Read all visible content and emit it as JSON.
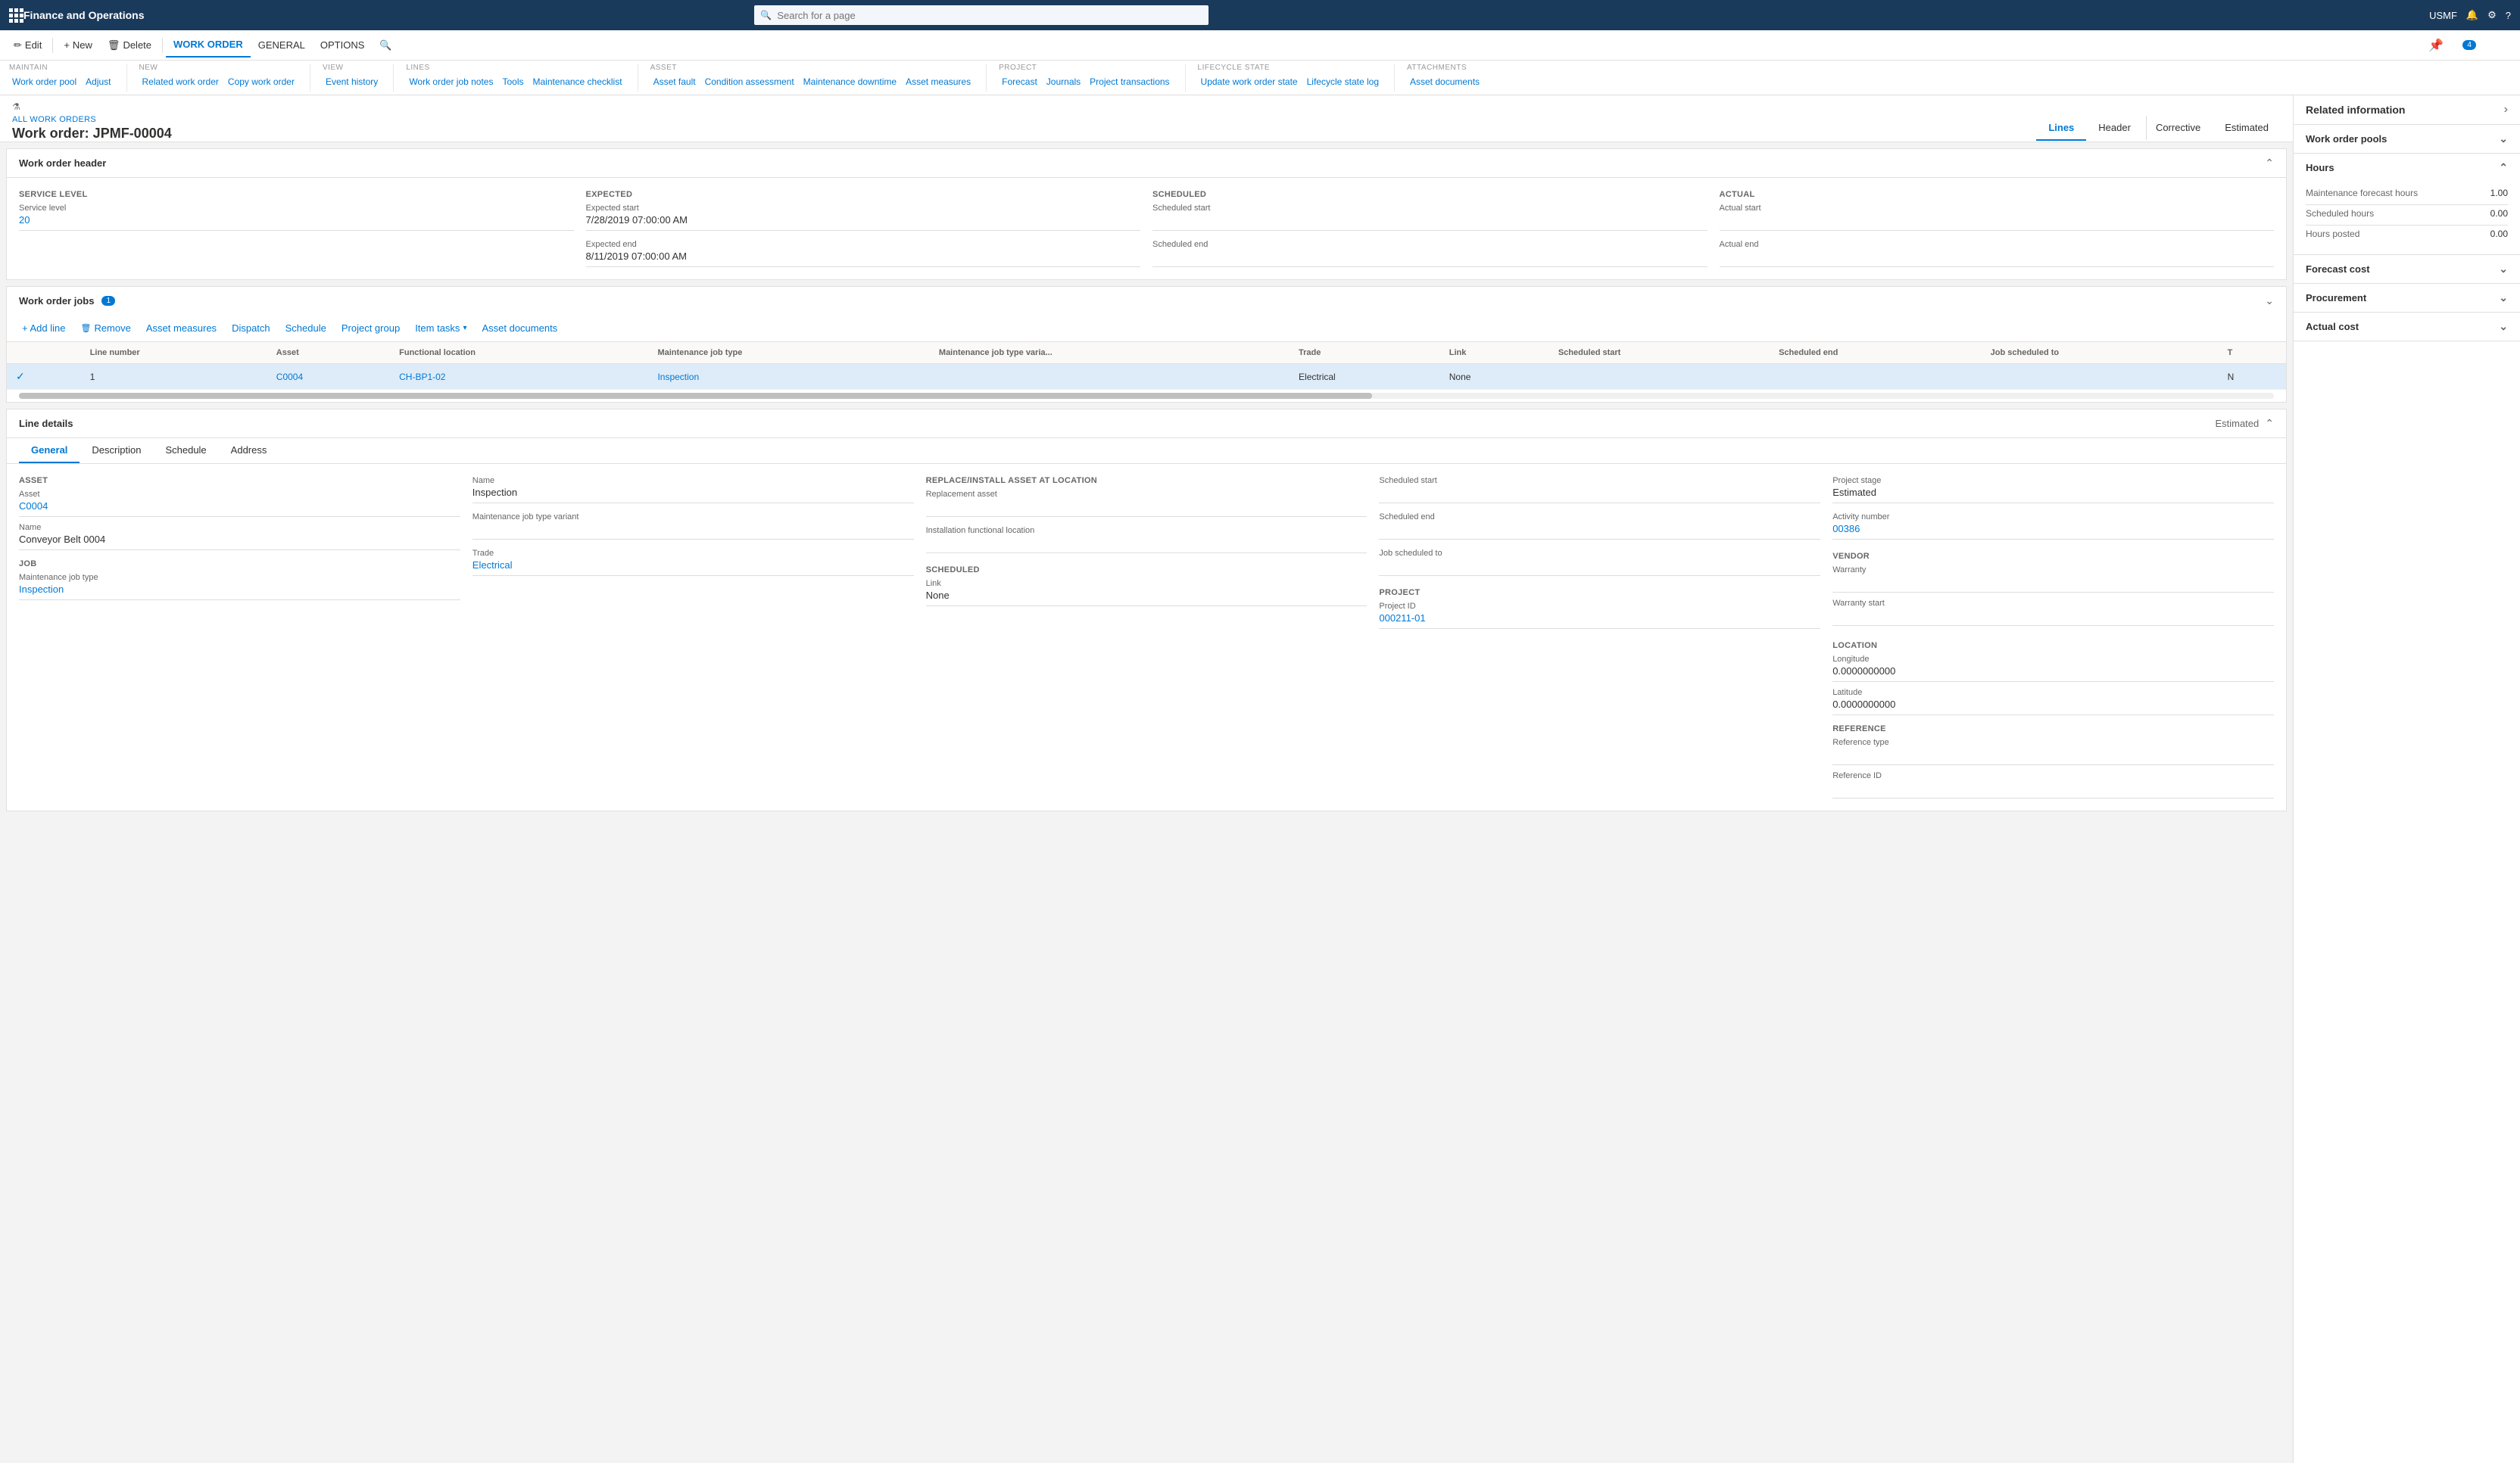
{
  "app": {
    "title": "Finance and Operations",
    "search_placeholder": "Search for a page",
    "user": "USMF"
  },
  "command_bar": {
    "edit_label": "Edit",
    "new_label": "New",
    "delete_label": "Delete",
    "work_order_label": "WORK ORDER",
    "general_label": "GENERAL",
    "options_label": "OPTIONS"
  },
  "ribbon": {
    "maintain_label": "MAINTAIN",
    "maintain_items": [
      "Work order pool",
      "Adjust"
    ],
    "new_label": "NEW",
    "new_items": [
      "Related work order",
      "Copy work order"
    ],
    "view_label": "VIEW",
    "view_items": [
      "Event history"
    ],
    "lines_label": "LINES",
    "lines_items": [
      "Work order job notes",
      "Tools",
      "Maintenance checklist"
    ],
    "asset_label": "ASSET",
    "asset_items": [
      "Asset fault",
      "Condition assessment",
      "Maintenance downtime",
      "Asset measures"
    ],
    "project_label": "PROJECT",
    "project_items": [
      "Forecast",
      "Journals",
      "Project transactions"
    ],
    "lifecycle_label": "LIFECYCLE STATE",
    "lifecycle_items": [
      "Update work order state",
      "Lifecycle state log"
    ],
    "attachments_label": "ATTACHMENTS",
    "attachments_items": [
      "Asset documents"
    ]
  },
  "page": {
    "breadcrumb": "ALL WORK ORDERS",
    "title": "Work order: JPMF-00004",
    "tabs": [
      "Lines",
      "Header",
      "Corrective",
      "Estimated"
    ]
  },
  "work_order_header": {
    "section_title": "Work order header",
    "service_level_label": "SERVICE LEVEL",
    "service_level_sub": "Service level",
    "service_level_value": "20",
    "expected_label": "EXPECTED",
    "expected_start_label": "Expected start",
    "expected_start_value": "7/28/2019 07:00:00 AM",
    "expected_end_label": "Expected end",
    "expected_end_value": "8/11/2019 07:00:00 AM",
    "scheduled_label": "SCHEDULED",
    "scheduled_start_label": "Scheduled start",
    "scheduled_end_label": "Scheduled end",
    "actual_label": "ACTUAL",
    "actual_start_label": "Actual start",
    "actual_end_label": "Actual end"
  },
  "work_order_jobs": {
    "section_title": "Work order jobs",
    "count": "1",
    "toolbar": {
      "add_line": "+ Add line",
      "remove": "Remove",
      "asset_measures": "Asset measures",
      "dispatch": "Dispatch",
      "schedule": "Schedule",
      "project_group": "Project group",
      "item_tasks": "Item tasks",
      "asset_documents": "Asset documents"
    },
    "columns": [
      "",
      "Line number",
      "Asset",
      "Functional location",
      "Maintenance job type",
      "Maintenance job type varia...",
      "Trade",
      "Link",
      "Scheduled start",
      "Scheduled end",
      "Job scheduled to",
      "T"
    ],
    "rows": [
      {
        "checked": true,
        "line_number": "1",
        "asset": "C0004",
        "functional_location": "CH-BP1-02",
        "maintenance_job_type": "Inspection",
        "maintenance_job_type_variant": "",
        "trade": "Electrical",
        "link": "None",
        "scheduled_start": "",
        "scheduled_end": "",
        "job_scheduled_to": "",
        "t": "N"
      }
    ]
  },
  "line_details": {
    "section_title": "Line details",
    "estimated_label": "Estimated",
    "tabs": [
      "General",
      "Description",
      "Schedule",
      "Address"
    ],
    "asset_section": {
      "label": "ASSET",
      "asset_label": "Asset",
      "asset_value": "C0004",
      "name_label": "Name",
      "name_value": "Conveyor Belt 0004"
    },
    "job_section": {
      "label": "JOB",
      "maintenance_job_type_label": "Maintenance job type",
      "maintenance_job_type_value": "Inspection"
    },
    "name_field": {
      "label": "Name",
      "value": "Inspection"
    },
    "maintenance_job_type_variant_label": "Maintenance job type variant",
    "trade_label": "Trade",
    "trade_value": "Electrical",
    "replace_install_label": "REPLACE/INSTALL ASSET AT LOCATION",
    "replacement_asset_label": "Replacement asset",
    "installation_functional_location_label": "Installation functional location",
    "scheduled_section": {
      "label": "SCHEDULED",
      "link_label": "Link",
      "link_value": "None"
    },
    "scheduled_start_label": "Scheduled start",
    "scheduled_end_label": "Scheduled end",
    "job_scheduled_to_label": "Job scheduled to",
    "project_section": {
      "label": "PROJECT",
      "project_id_label": "Project ID",
      "project_id_value": "000211-01"
    },
    "project_stage_label": "Project stage",
    "project_stage_value": "Estimated",
    "activity_number_label": "Activity number",
    "activity_number_value": "00386",
    "vendor_section": {
      "label": "VENDOR",
      "warranty_label": "Warranty"
    },
    "warranty_start_label": "Warranty start",
    "location_section": {
      "label": "LOCATION",
      "longitude_label": "Longitude",
      "longitude_value": "0.0000000000",
      "latitude_label": "Latitude",
      "latitude_value": "0.0000000000"
    },
    "reference_section": {
      "label": "REFERENCE",
      "reference_type_label": "Reference type",
      "reference_id_label": "Reference ID"
    }
  },
  "right_panel": {
    "title": "Related information",
    "work_order_pools_label": "Work order pools",
    "hours_label": "Hours",
    "maintenance_forecast_hours_label": "Maintenance forecast hours",
    "maintenance_forecast_hours_value": "1.00",
    "scheduled_hours_label": "Scheduled hours",
    "scheduled_hours_value": "0.00",
    "hours_posted_label": "Hours posted",
    "hours_posted_value": "0.00",
    "forecast_cost_label": "Forecast cost",
    "procurement_label": "Procurement",
    "actual_cost_label": "Actual cost"
  }
}
